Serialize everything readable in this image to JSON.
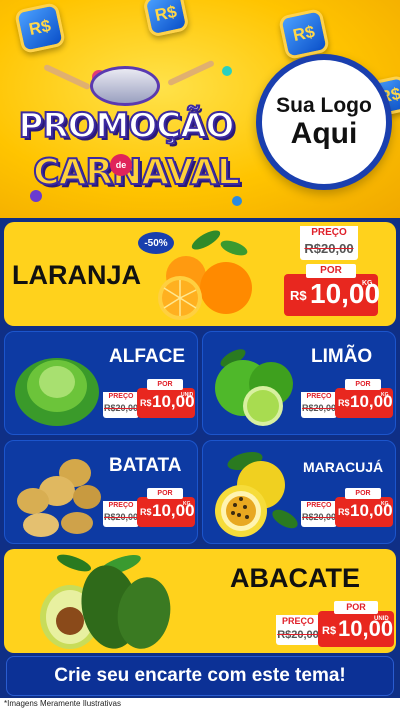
{
  "header": {
    "coin_symbol": "R$",
    "promo_title": "PROMOÇÃO",
    "promo_connector": "de",
    "promo_subtitle": "CARNAVAL",
    "logo_line1": "Sua Logo",
    "logo_line2": "Aqui"
  },
  "products": {
    "laranja": {
      "name": "LARANJA",
      "discount": "-50%",
      "old_label": "PREÇO",
      "old_price": "R$20,00",
      "new_label": "POR",
      "currency": "R$",
      "price": "10,00",
      "unit": "KG",
      "icon": "orange-icon"
    },
    "alface": {
      "name": "ALFACE",
      "old_label": "PREÇO",
      "old_price": "R$20,00",
      "new_label": "POR",
      "currency": "R$",
      "price": "10,00",
      "unit": "UNID",
      "icon": "lettuce-icon"
    },
    "limao": {
      "name": "LIMÃO",
      "old_label": "PREÇO",
      "old_price": "R$20,00",
      "new_label": "POR",
      "currency": "R$",
      "price": "10,00",
      "unit": "KG",
      "icon": "lime-icon"
    },
    "batata": {
      "name": "BATATA",
      "old_label": "PREÇO",
      "old_price": "R$20,00",
      "new_label": "POR",
      "currency": "R$",
      "price": "10,00",
      "unit": "KG",
      "icon": "potato-icon"
    },
    "maracuja": {
      "name": "MARACUJÁ",
      "old_label": "PREÇO",
      "old_price": "R$20,00",
      "new_label": "POR",
      "currency": "R$",
      "price": "10,00",
      "unit": "KG",
      "icon": "passion-fruit-icon"
    },
    "abacate": {
      "name": "ABACATE",
      "old_label": "PREÇO",
      "old_price": "R$20,00",
      "new_label": "POR",
      "currency": "R$",
      "price": "10,00",
      "unit": "UNID",
      "icon": "avocado-icon"
    }
  },
  "footer": {
    "cta": "Crie seu encarte com este tema!",
    "disclaimer": "*Imagens Meramente Ilustrativas"
  },
  "colors": {
    "yellow": "#ffd21c",
    "blue": "#0d3aa3",
    "red": "#e8271f",
    "navy": "#0f2f86"
  }
}
